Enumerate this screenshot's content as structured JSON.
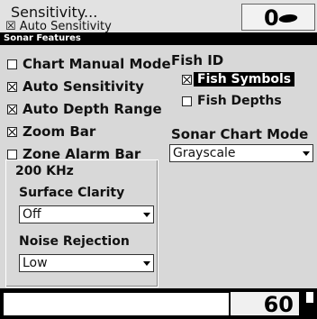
{
  "top": {
    "menu_label": "Sensitivity...",
    "menu_sub": "☒ Auto Sensitivity",
    "depth_value": "0"
  },
  "window": {
    "title": "Sonar Features"
  },
  "left_options": [
    {
      "label": "Chart Manual Mode",
      "checked": false
    },
    {
      "label": "Auto Sensitivity",
      "checked": true
    },
    {
      "label": "Auto Depth Range",
      "checked": true
    },
    {
      "label": "Zoom Bar",
      "checked": true
    },
    {
      "label": "Zone Alarm Bar",
      "checked": false
    }
  ],
  "fish_id": {
    "heading": "Fish ID",
    "symbols": {
      "label": "Fish Symbols",
      "checked": true
    },
    "depths": {
      "label": "Fish Depths",
      "checked": false
    }
  },
  "chart_mode": {
    "heading": "Sonar Chart Mode",
    "value": "Grayscale"
  },
  "khz_group": {
    "heading": "200 KHz",
    "surface_label": "Surface Clarity",
    "surface_value": "Off",
    "noise_label": "Noise Rejection",
    "noise_value": "Low"
  },
  "bottom": {
    "readout": "60"
  }
}
